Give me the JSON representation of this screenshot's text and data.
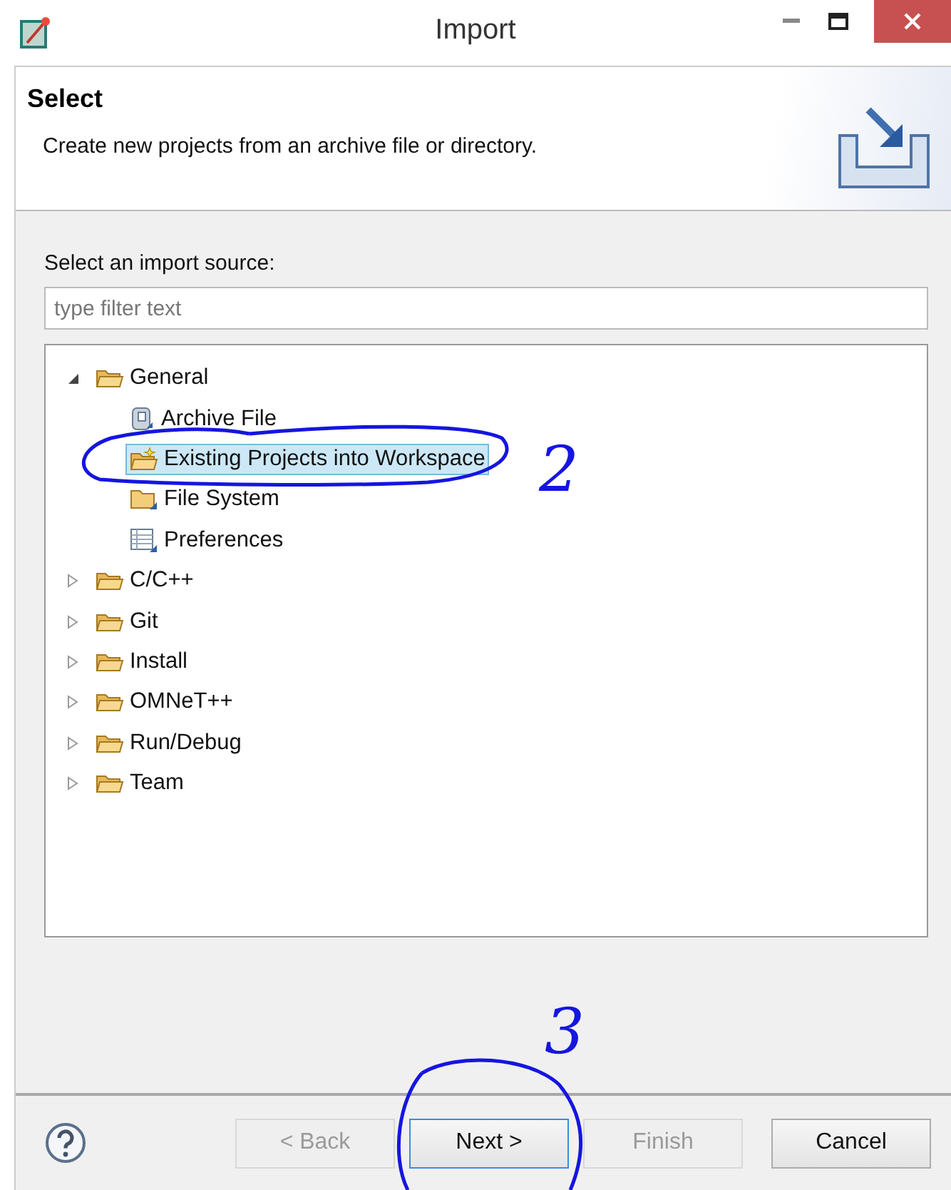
{
  "window": {
    "title": "Import"
  },
  "header": {
    "title": "Select",
    "description": "Create new projects from an archive file or directory."
  },
  "source_label": "Select an import source:",
  "filter": {
    "placeholder": "type filter text"
  },
  "tree": [
    {
      "label": "General",
      "expanded": true,
      "selected": false,
      "children": [
        {
          "label": "Archive File",
          "kind": "archive",
          "selected": false
        },
        {
          "label": "Existing Projects into Workspace",
          "kind": "project",
          "selected": true
        },
        {
          "label": "File System",
          "kind": "folder",
          "selected": false
        },
        {
          "label": "Preferences",
          "kind": "preferences",
          "selected": false
        }
      ]
    },
    {
      "label": "C/C++",
      "expanded": false,
      "selected": false
    },
    {
      "label": "Git",
      "expanded": false,
      "selected": false
    },
    {
      "label": "Install",
      "expanded": false,
      "selected": false
    },
    {
      "label": "OMNeT++",
      "expanded": false,
      "selected": false
    },
    {
      "label": "Run/Debug",
      "expanded": false,
      "selected": false
    },
    {
      "label": "Team",
      "expanded": false,
      "selected": false
    }
  ],
  "buttons": [
    {
      "label": "< Back",
      "disabled": true,
      "focused": false
    },
    {
      "label": "Next >",
      "disabled": false,
      "focused": true
    },
    {
      "label": "Finish",
      "disabled": true,
      "focused": false
    },
    {
      "label": "Cancel",
      "disabled": false,
      "focused": false
    }
  ],
  "annotations": [
    {
      "text": "2"
    },
    {
      "text": "3"
    }
  ]
}
